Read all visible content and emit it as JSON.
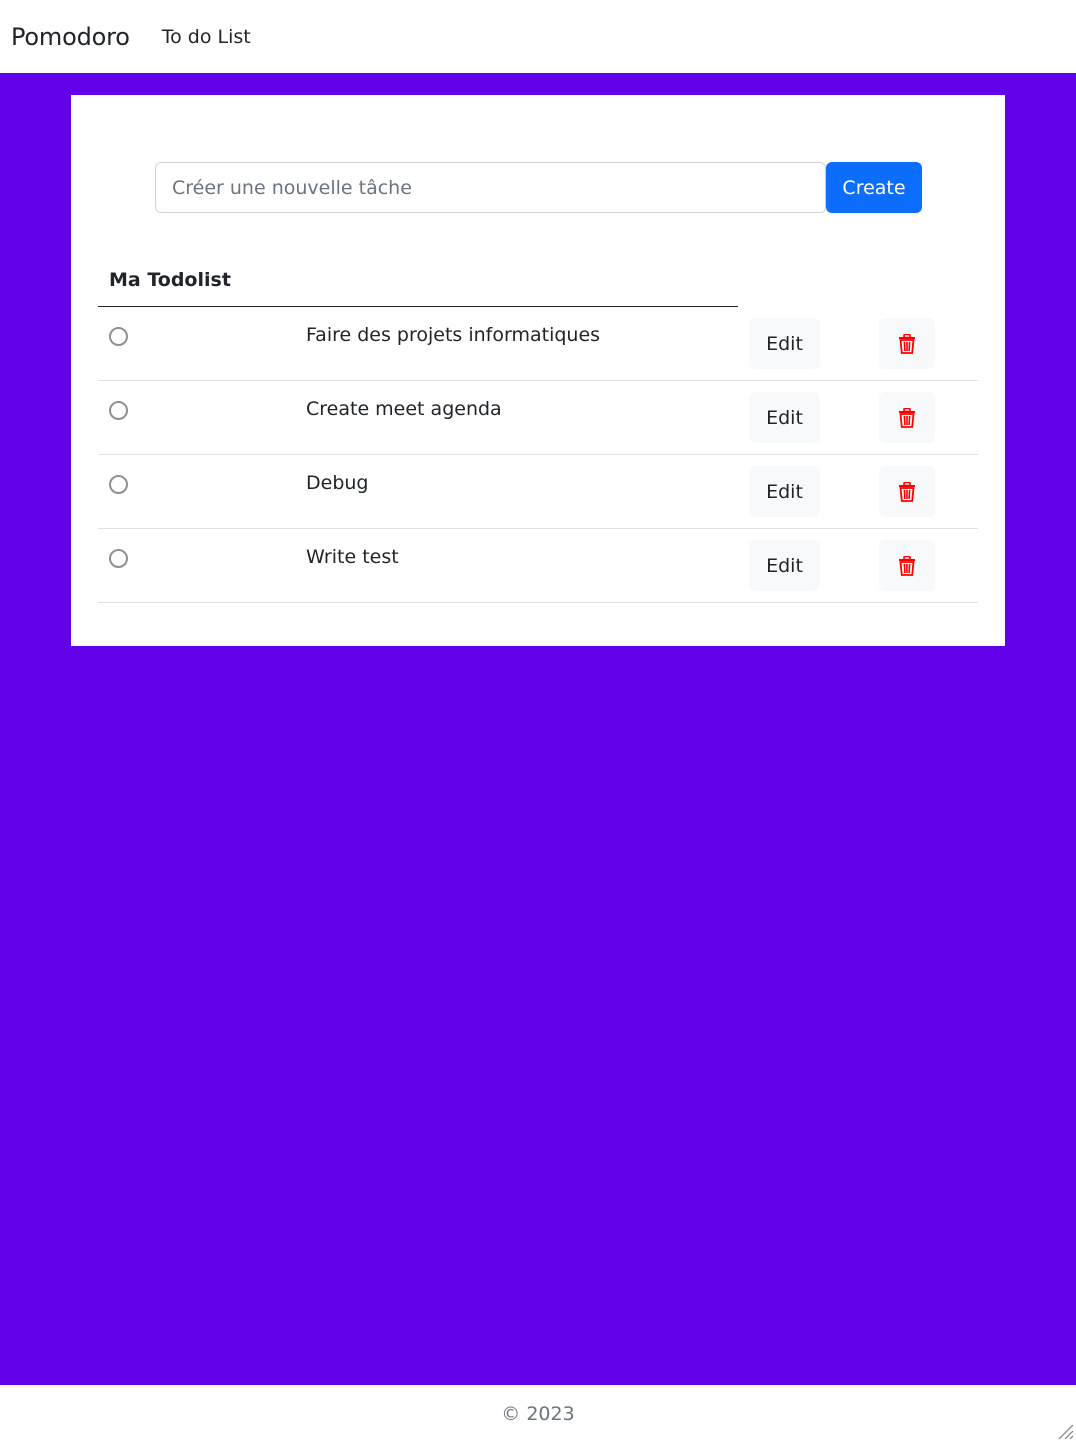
{
  "navbar": {
    "brand": "Pomodoro",
    "links": [
      {
        "label": "To do List"
      }
    ]
  },
  "new_task": {
    "placeholder": "Créer une nouvelle tâche",
    "value": "",
    "create_label": "Create"
  },
  "todo_list": {
    "title": "Ma Todolist",
    "edit_label": "Edit",
    "items": [
      {
        "text": "Faire des projets informatiques",
        "done": false
      },
      {
        "text": "Create meet agenda",
        "done": false
      },
      {
        "text": "Debug",
        "done": false
      },
      {
        "text": "Write test",
        "done": false
      }
    ]
  },
  "footer": {
    "copyright": "© 2023"
  },
  "colors": {
    "page_background": "#6200ea",
    "primary_button": "#0d6efd",
    "delete_icon": "#ff0000",
    "light_button": "#f8f9fa"
  },
  "icons": {
    "delete": "trash-icon",
    "status": "radio-circle-icon"
  }
}
